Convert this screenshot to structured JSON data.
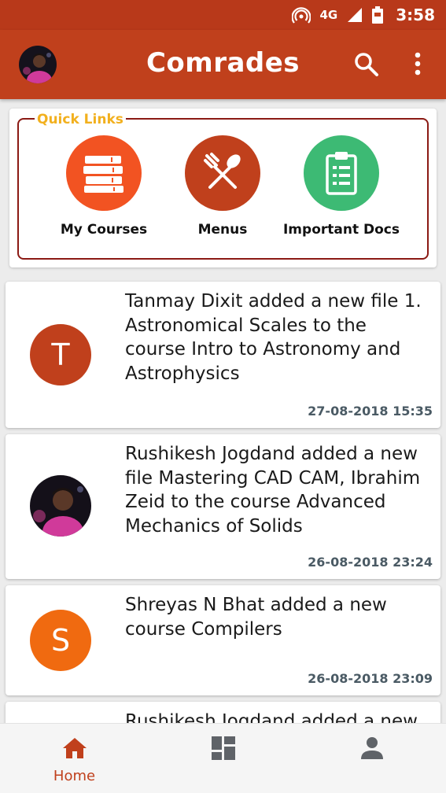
{
  "status_bar": {
    "network": "4G",
    "time": "3:58",
    "icons": [
      "hotspot-icon",
      "signal-icon",
      "battery-icon"
    ]
  },
  "app_bar": {
    "title": "Comrades",
    "icons": [
      "avatar",
      "search-icon",
      "more-vert-icon"
    ],
    "color": "#c0401c"
  },
  "quick_links": {
    "legend": "Quick Links",
    "items": [
      {
        "label": "My Courses",
        "icon": "books-icon",
        "color": "#f25322"
      },
      {
        "label": "Menus",
        "icon": "fork-spoon-icon",
        "color": "#c0401c"
      },
      {
        "label": "Important Docs",
        "icon": "clipboard-icon",
        "color": "#3dba74"
      }
    ]
  },
  "feed": [
    {
      "avatar_letter": "T",
      "avatar_color": "#c0401c",
      "text": "Tanmay Dixit added a new file 1. Astronomical Scales to the course Intro to Astronomy and Astrophysics",
      "date": "27-08-2018 15:35"
    },
    {
      "avatar_letter": "",
      "avatar_type": "photo",
      "text": "Rushikesh Jogdand added a new file Mastering CAD CAM, Ibrahim Zeid to the course Advanced Mechanics of Solids",
      "date": "26-08-2018 23:24"
    },
    {
      "avatar_letter": "S",
      "avatar_color": "#f06a10",
      "text": "Shreyas N Bhat added a new course Compilers",
      "date": "26-08-2018 23:09"
    },
    {
      "text": "Rushikesh Jogdand added a new"
    }
  ],
  "bottom_nav": {
    "items": [
      {
        "label": "Home",
        "icon": "home-icon",
        "active": true
      },
      {
        "label": "",
        "icon": "dashboard-icon",
        "active": false
      },
      {
        "label": "",
        "icon": "person-icon",
        "active": false
      }
    ]
  }
}
